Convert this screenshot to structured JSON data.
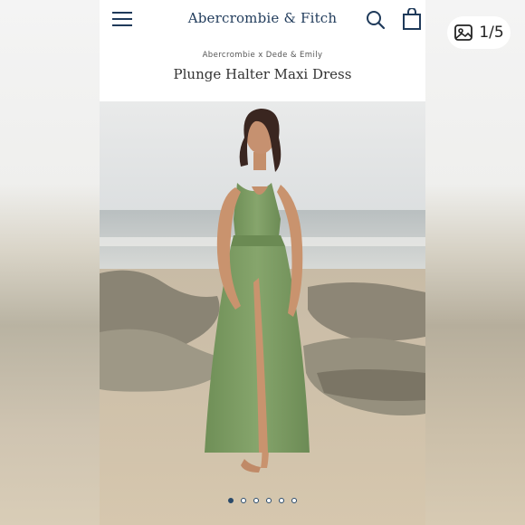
{
  "header": {
    "brand": "Abercrombie & Fitch",
    "menu_icon": "hamburger-menu-icon",
    "search_icon": "search-icon",
    "bag_icon": "shopping-bag-icon"
  },
  "product": {
    "collab": "Abercrombie x Dede & Emily",
    "title": "Plunge Halter Maxi Dress",
    "color_accent": "#7a9a62"
  },
  "carousel": {
    "total": 6,
    "active_index": 0
  },
  "counter": {
    "icon": "image-gallery-icon",
    "text": "1/5"
  },
  "colors": {
    "brand_navy": "#1f3a5a",
    "dress_green": "#7c9b63"
  }
}
